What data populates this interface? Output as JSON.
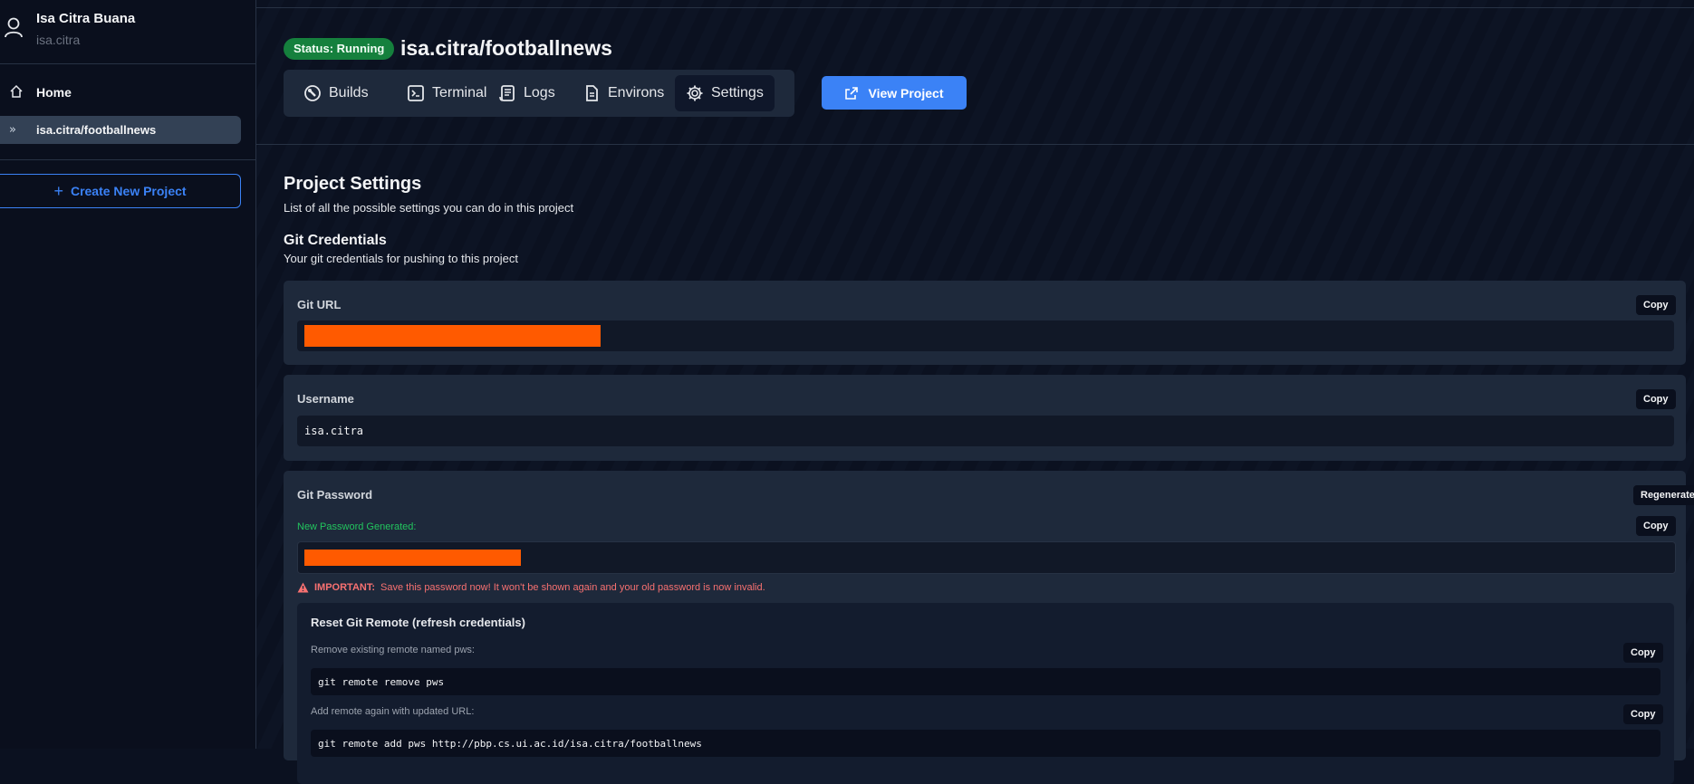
{
  "user": {
    "name": "Isa Citra Buana",
    "handle": "isa.citra",
    "icon": "user-icon"
  },
  "sidebar": {
    "home_label": "Home",
    "project_label": "isa.citra/footballnews",
    "create_label": "Create New Project"
  },
  "header": {
    "status": "Status: Running",
    "title": "isa.citra/footballnews",
    "tabs": [
      {
        "label": "Builds",
        "icon": "build-icon"
      },
      {
        "label": "Terminal",
        "icon": "terminal-icon"
      },
      {
        "label": "Logs",
        "icon": "logs-icon"
      },
      {
        "label": "Environs",
        "icon": "document-icon"
      },
      {
        "label": "Settings",
        "icon": "gear-icon",
        "active": true
      }
    ],
    "view_project": "View Project"
  },
  "settings": {
    "title": "Project Settings",
    "subtitle": "List of all the possible settings you can do in this project",
    "git_title": "Git Credentials",
    "git_subtitle": "Your git credentials for pushing to this project"
  },
  "git_url": {
    "label": "Git URL",
    "copy": "Copy"
  },
  "username": {
    "label": "Username",
    "value": "isa.citra",
    "copy": "Copy"
  },
  "password": {
    "label": "Git Password",
    "regenerate": "Regenerate",
    "copy": "Copy",
    "generated_note": "New Password Generated:",
    "important_prefix": "IMPORTANT:",
    "important_text": "Save this password now! It won't be shown again and your old password is now invalid."
  },
  "reset_remote": {
    "title": "Reset Git Remote (refresh credentials)",
    "step1_label": "Remove existing remote named pws:",
    "step1_cmd": "git remote remove pws",
    "step2_label": "Add remote again with updated URL:",
    "step2_cmd": "git remote add pws http://pbp.cs.ui.ac.id/isa.citra/footballnews",
    "copy": "Copy"
  },
  "colors": {
    "accent": "#3b82f6",
    "status": "#15803d",
    "redaction": "#ff5a00",
    "warning": "#f87171",
    "success": "#22c55e"
  }
}
